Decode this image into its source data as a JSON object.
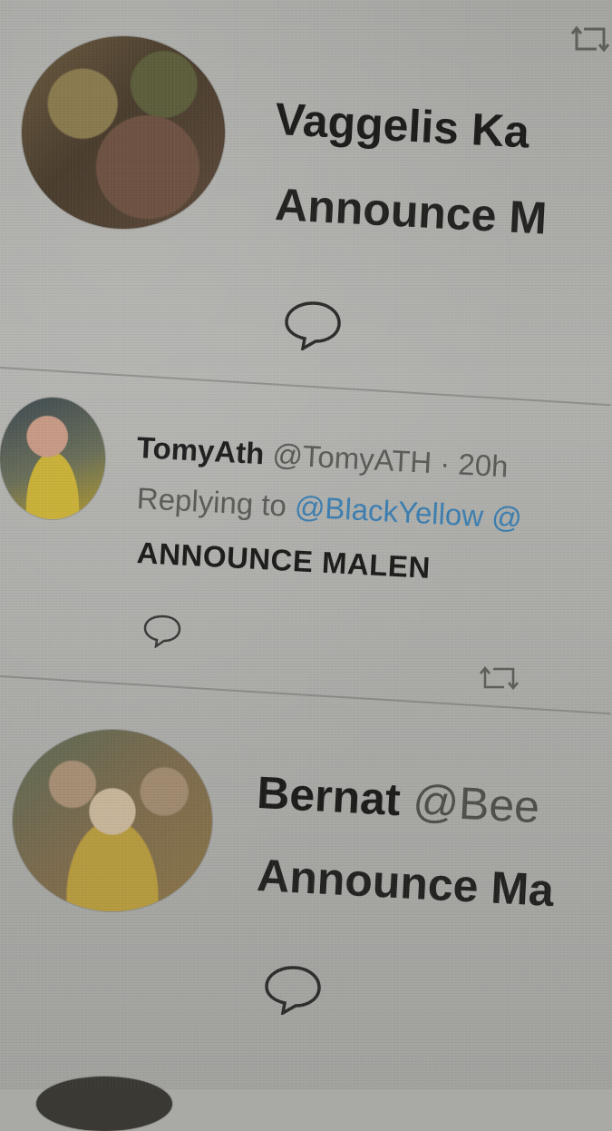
{
  "tweets": [
    {
      "name": "Vaggelis Ka",
      "handle": "",
      "body": "Announce M"
    },
    {
      "name": "TomyAth",
      "handle": "@TomyATH",
      "time": "· 20h",
      "reply_prefix": "Replying to ",
      "reply_link": "@BlackYellow @",
      "body": "ANNOUNCE MALEN"
    },
    {
      "name": "Bernat",
      "handle": "@Bee",
      "body": "Announce Ma"
    }
  ],
  "icons": {
    "reply": "speech-bubble-icon",
    "retweet": "retweet-icon"
  },
  "colors": {
    "background": "#a9a9a6",
    "text": "#1d1d1b",
    "muted": "#5b5b58",
    "link": "#3d7fb0"
  }
}
